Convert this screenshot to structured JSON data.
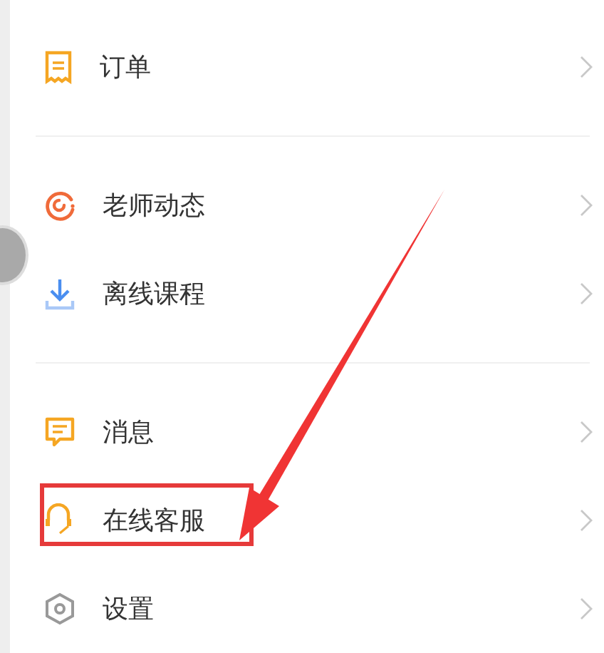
{
  "menu_groups": [
    {
      "items": [
        {
          "label": "订单",
          "highlighted": false
        }
      ]
    },
    {
      "items": [
        {
          "label": "老师动态",
          "highlighted": false
        },
        {
          "label": "离线课程",
          "highlighted": false
        }
      ]
    },
    {
      "items": [
        {
          "label": "消息",
          "highlighted": false
        },
        {
          "label": "在线客服",
          "highlighted": true
        },
        {
          "label": "设置",
          "highlighted": false
        }
      ]
    }
  ]
}
